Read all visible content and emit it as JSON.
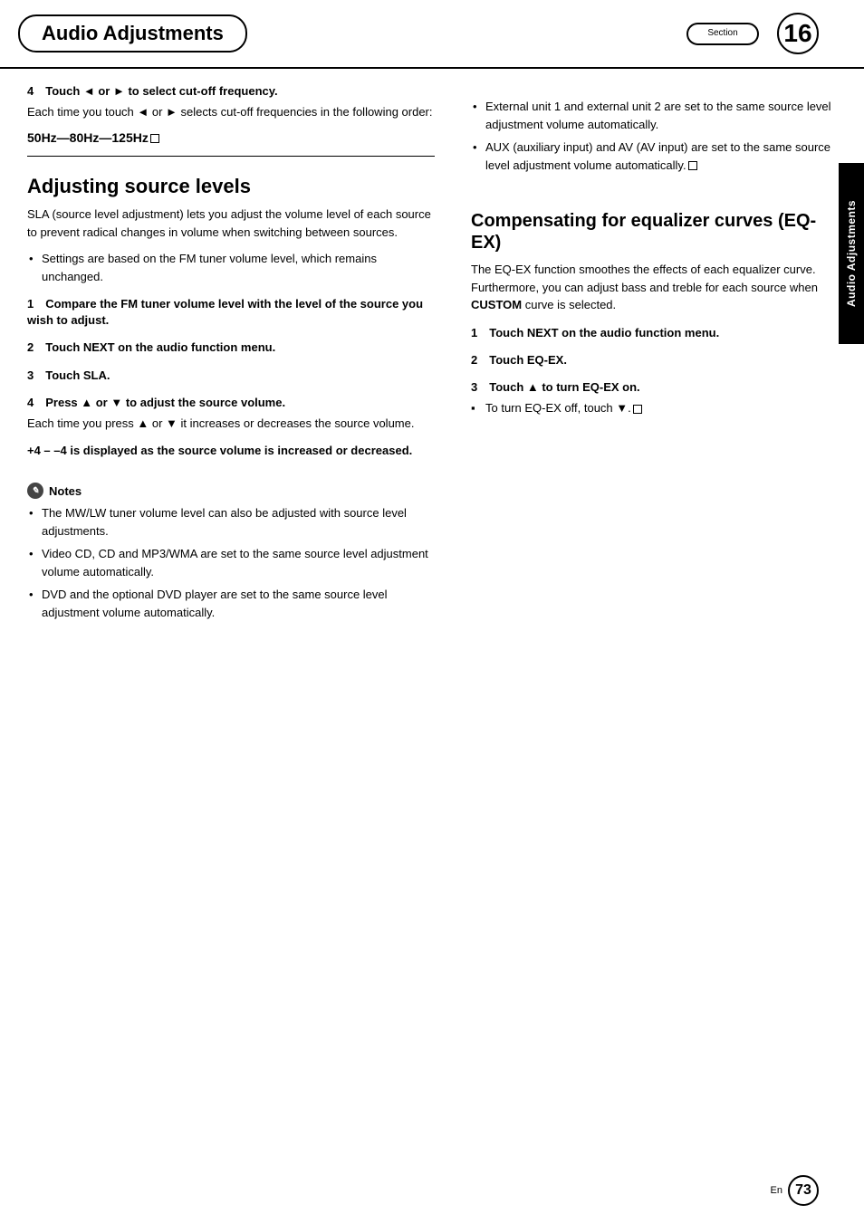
{
  "header": {
    "title": "Audio Adjustments",
    "section_label": "Section",
    "section_number": "16"
  },
  "sidebar": {
    "label": "Audio Adjustments"
  },
  "footer": {
    "lang": "En",
    "page_number": "73"
  },
  "left_col": {
    "step4_heading": "4 Touch ◄ or ► to select cut-off frequency.",
    "step4_body": "Each time you touch ◄ or ► selects cut-off frequencies in the following order:",
    "step4_freq": "50Hz—80Hz—125Hz",
    "section_title": "Adjusting source levels",
    "section_intro": "SLA (source level adjustment) lets you adjust the volume level of each source to prevent radical changes in volume when switching between sources.",
    "bullet1": "Settings are based on the FM tuner volume level, which remains unchanged.",
    "step1_heading": "1 Compare the FM tuner volume level with the level of the source you wish to adjust.",
    "step2_heading": "2 Touch NEXT on the audio function menu.",
    "step3_heading": "3 Touch SLA.",
    "step4b_heading": "4 Press ▲ or ▼ to adjust the source volume.",
    "step4b_body": "Each time you press ▲ or ▼ it increases or decreases the source volume.",
    "step4b_range": "+4 – –4 is displayed as the source volume is increased or decreased.",
    "notes_label": "Notes",
    "note1": "The MW/LW tuner volume level can also be adjusted with source level adjustments.",
    "note2": "Video CD, CD and MP3/WMA are set to the same source level adjustment volume automatically.",
    "note3": "DVD and the optional DVD player are set to the same source level adjustment volume automatically."
  },
  "right_col": {
    "bullet1": "External unit 1 and external unit 2 are set to the same source level adjustment volume automatically.",
    "bullet2": "AUX (auxiliary input) and AV (AV input) are set to the same source level adjustment volume automatically.",
    "section_title": "Compensating for equalizer curves (EQ-EX)",
    "section_intro": "The EQ-EX function smoothes the effects of each equalizer curve. Furthermore, you can adjust bass and treble for each source when CUSTOM curve is selected.",
    "custom_bold": "CUSTOM",
    "step1_heading": "1 Touch NEXT on the audio function menu.",
    "step2_heading": "2 Touch EQ-EX.",
    "step3_heading": "3 Touch ▲ to turn EQ-EX on.",
    "step3_bullet": "To turn EQ-EX off, touch ▼."
  }
}
